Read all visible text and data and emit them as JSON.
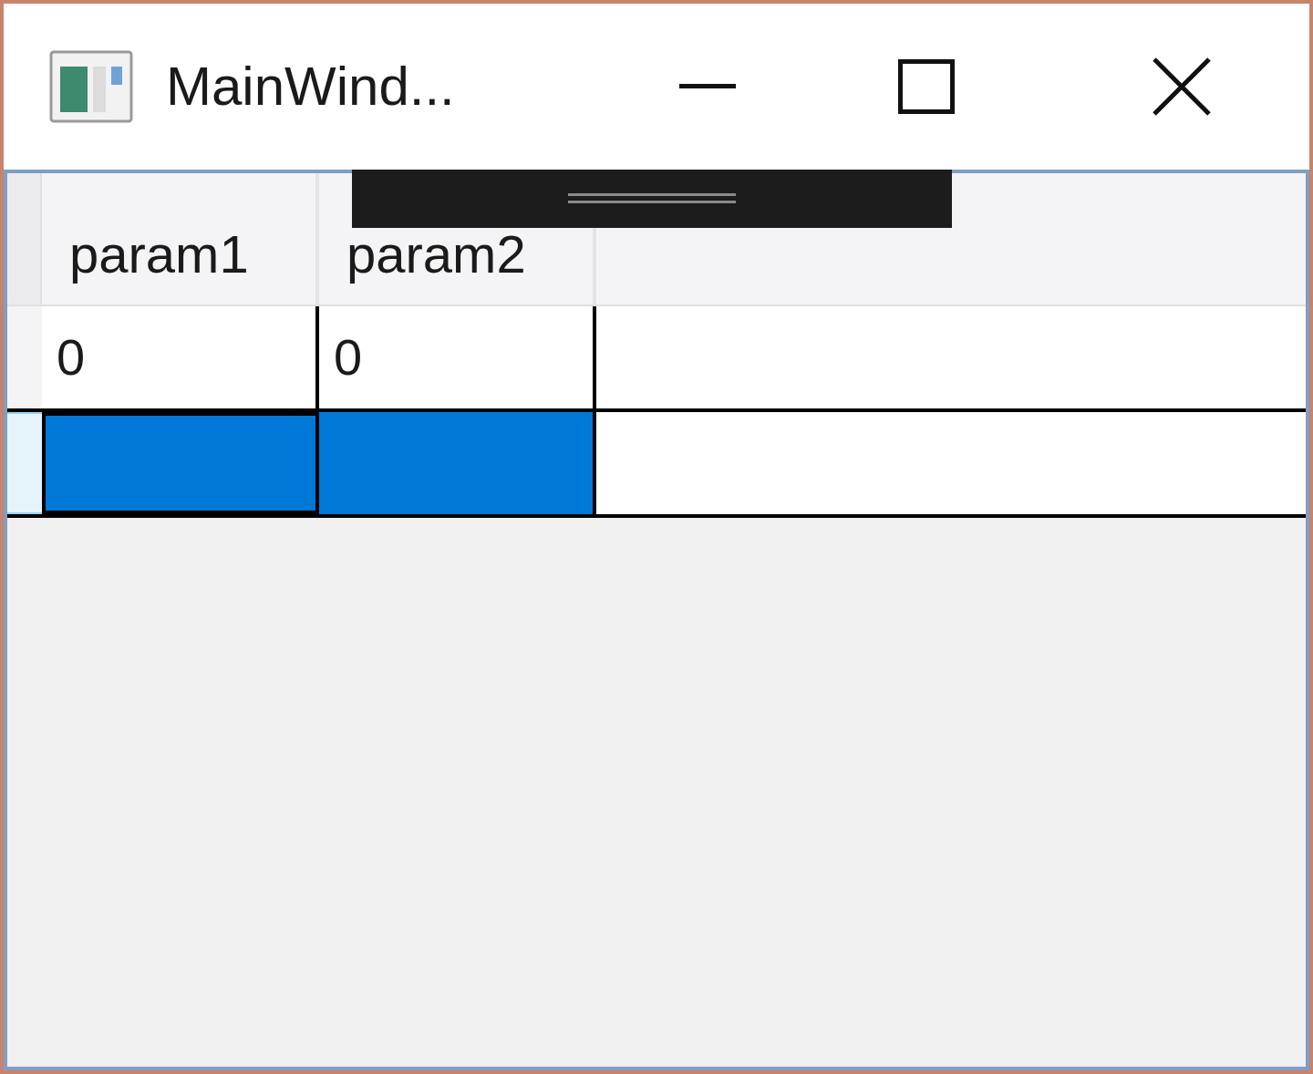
{
  "window": {
    "title": "MainWind..."
  },
  "table": {
    "columns": [
      "param1",
      "param2"
    ],
    "rows": [
      {
        "cells": [
          "0",
          "0"
        ],
        "selected": false
      },
      {
        "cells": [],
        "selected": true
      }
    ]
  }
}
